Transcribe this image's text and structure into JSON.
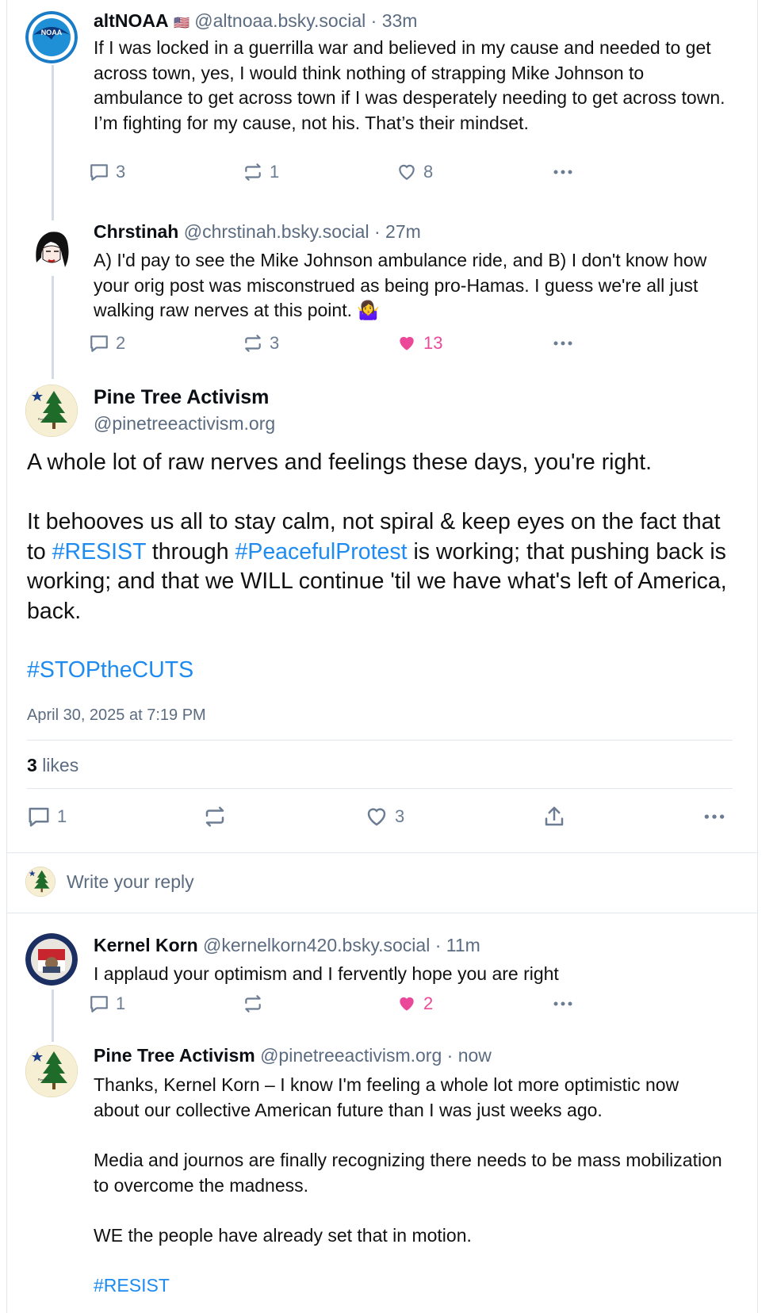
{
  "colors": {
    "accent": "#1d8bf0",
    "liked": "#ec4899",
    "muted": "#6b7c93"
  },
  "posts": [
    {
      "name": "altNOAA",
      "flag": "🇺🇸",
      "handle": "@altnoaa.bsky.social",
      "time": "33m",
      "text": "If I was locked in a guerrilla war and believed in my cause and needed to get across town, yes, I would think nothing of strapping Mike Johnson to ambulance to get across town if I was desperately needing to get across town. I’m fighting for my cause, not his. That’s their mindset.",
      "replies": "3",
      "reposts": "1",
      "likes": "8"
    },
    {
      "name": "Chrstinah",
      "handle": "@chrstinah.bsky.social",
      "time": "27m",
      "text": "A) I'd pay to see the Mike Johnson ambulance ride, and B) I don't know how your orig post was misconstrued as being pro-Hamas. I guess we're all just walking raw nerves at this point. 🤷‍♀️",
      "replies": "2",
      "reposts": "3",
      "likes": "13"
    }
  ],
  "main": {
    "name": "Pine Tree Activism",
    "handle": "@pinetreeactivism.org",
    "line1": "A whole lot of raw nerves and feelings these days, you're right.",
    "p2_a": "It behooves us all to stay calm, not spiral & keep eyes on the fact that to ",
    "tag_resist": "#RESIST",
    "p2_b": " through ",
    "tag_peaceful": "#PeacefulProtest",
    "p2_c": " is working; that pushing back is working; and that we WILL continue 'til we have what's left of America, back.",
    "tag_cuts": "#STOPtheCUTS",
    "timestamp": "April 30, 2025 at 7:19 PM",
    "likes_count": "3",
    "likes_label": "likes",
    "replies": "1",
    "likes": "3"
  },
  "reply_box": {
    "placeholder": "Write your reply"
  },
  "replies": [
    {
      "name": "Kernel Korn",
      "handle": "@kernelkorn420.bsky.social",
      "time": "11m",
      "text": "I applaud your optimism and I fervently hope you are right",
      "replies": "1",
      "likes": "2"
    },
    {
      "name": "Pine Tree Activism",
      "handle": "@pinetreeactivism.org",
      "time": "now",
      "p1": "Thanks, Kernel Korn – I know I'm feeling a whole lot more optimistic now about our collective American future than I was just weeks ago.",
      "p2": "Media and journos are finally recognizing there needs to be mass mobilization to overcome the madness.",
      "p3": "WE the people have already set that in motion.",
      "tag": "#RESIST"
    }
  ]
}
